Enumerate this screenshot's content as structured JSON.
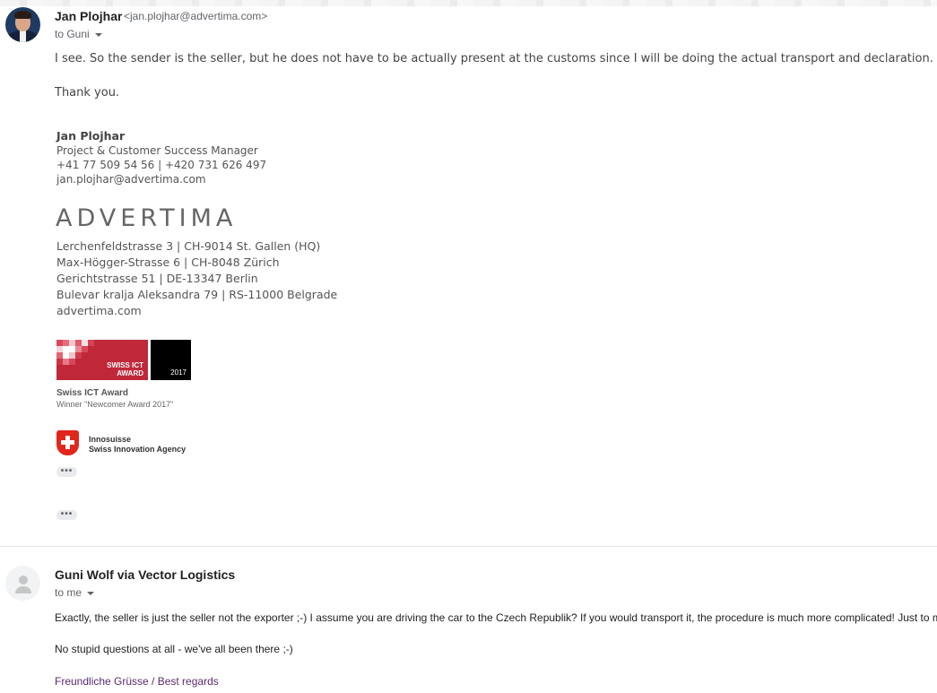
{
  "message1": {
    "sender_name": "Jan Plojhar",
    "sender_email": "<jan.plojhar@advertima.com>",
    "to_line": "to Guni",
    "body_line1": "I see. So the sender is the seller, but he does not have to be actually present at the customs since I will be doing the actual transport and declaration.",
    "body_line2": "Thank you.",
    "signature": {
      "name": "Jan Plojhar",
      "role": "Project & Customer Success Manager",
      "phones": "+41 77 509 54 56 | +420 731 626 497",
      "email": "jan.plojhar@advertima.com",
      "logo": "ADVERTIMA",
      "addresses": [
        "Lerchenfeldstrasse 3 | CH-9014 St. Gallen (HQ)",
        "Max-Högger-Strasse 6 | CH-8048 Zürich",
        "Gerichtstrasse 51 | DE-13347 Berlin",
        "Bulevar kralja Aleksandra 79 | RS-11000 Belgrade"
      ],
      "website": "advertima.com",
      "award_badge_line1": "SWISS ICT",
      "award_badge_line2": "AWARD",
      "award_year": "2017",
      "award_caption": "Swiss ICT Award",
      "award_sub": "Winner \"Newcomer Award 2017\"",
      "innosuisse_line1": "Innosuisse",
      "innosuisse_line2": "Swiss Innovation Agency"
    },
    "ellipsis": "•••"
  },
  "message2": {
    "sender_name": "Guni Wolf via Vector Logistics",
    "to_line": "to me",
    "body_line1": "Exactly, the seller is just the seller not the exporter ;-) I assume you are driving the car to the Czech Republik? If you would transport it, the procedure is much more complicated! Just to m",
    "body_line2": "No stupid questions at all - we've all been there ;-)",
    "regards": "Freundliche Grüsse / Best regards"
  }
}
